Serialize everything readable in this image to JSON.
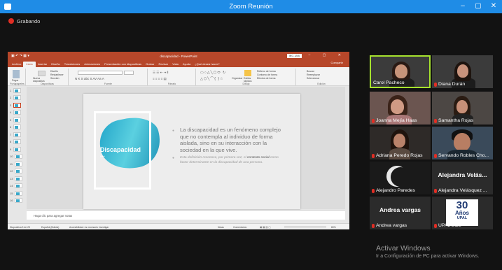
{
  "window": {
    "title": "Zoom Reunión",
    "minimize": "–",
    "maximize": "▢",
    "close": "✕"
  },
  "recording": {
    "label": "Grabando"
  },
  "powerpoint": {
    "title": "discapacidad - PowerPoint",
    "user_initials": "ING. ANA",
    "tabs": [
      "Archivo",
      "Inicio",
      "Insertar",
      "Diseño",
      "Transiciones",
      "Animaciones",
      "Presentación con diapositivas",
      "Grabar",
      "Revisar",
      "Vista",
      "Ayuda",
      "¿Qué desea hacer?"
    ],
    "active_tab": "Inicio",
    "share": "Compartir",
    "ribbon_groups": [
      "Portapapeles",
      "Diapositivas",
      "Fuente",
      "Párrafo",
      "Dibujo",
      "Edición"
    ],
    "ribbon_buttons": {
      "paste": "Pegar",
      "new_slide": "Nueva diapositiva",
      "layout": "Diseño",
      "reset": "Restablecer",
      "section": "Sección",
      "arrange": "Organizar",
      "quick_styles": "Estilos rápidos",
      "find": "Buscar",
      "replace": "Reemplazar",
      "select": "Seleccionar",
      "shape_fill": "Relleno de forma",
      "shape_outline": "Contorno de forma",
      "shape_effects": "Efectos de forma"
    },
    "slide_numbers": [
      "1",
      "2",
      "3",
      "4",
      "5",
      "6",
      "7",
      "8",
      "9",
      "10",
      "11",
      "12",
      "13",
      "14",
      "15",
      "16"
    ],
    "selected_slide": "3",
    "slide": {
      "title": "Discapacidad",
      "title_dots": "...",
      "bullet1": "La discapacidad es un fenómeno complejo que no contempla al individuo de forma aislada, sino en su interacción con la sociedad en la que vive.",
      "bullet2_a": "Esta definición reconoce, por primera vez,",
      "bullet2_b": "el ",
      "bullet2_em": "contexto social",
      "bullet2_c": " como factor determinante en la discapacidad de una persona."
    },
    "notes_placeholder": "Haga clic para agregar notas",
    "status": {
      "slide_count": "Diapositiva 3 de 23",
      "language": "Español (Bolivia)",
      "accessibility": "Accesibilidad: es necesario investigar",
      "notes": "Notas",
      "comments": "Comentarios",
      "zoom": "80%"
    }
  },
  "participants": [
    {
      "name": "Carol Pacheco",
      "active": true,
      "muted": false
    },
    {
      "name": "Diana Durán",
      "muted": true
    },
    {
      "name": "Joanna Mejía Haas",
      "muted": true
    },
    {
      "name": "Samantha Rojas",
      "muted": true
    },
    {
      "name": "Adriana Peredo Rojas",
      "muted": true
    },
    {
      "name": "Servando Robles Cho...",
      "muted": true
    },
    {
      "name": "Alejandro Paredes",
      "muted": true
    },
    {
      "name": "Alejandra Velás...",
      "name_full": "Alejandra Velásquez ...",
      "muted": true
    },
    {
      "name": "Andrea vargas",
      "muted": true
    },
    {
      "name": "UPAL BOL",
      "muted": true
    }
  ],
  "logo": {
    "number": "30",
    "years": "Años",
    "org": "UPAL"
  },
  "watermark": {
    "title": "Activar Windows",
    "subtitle": "Ir a Configuración de PC para activar Windows."
  },
  "colors": {
    "zoom_blue": "#1f8ce6",
    "ppt_orange": "#b7472a",
    "active_speaker": "#a6e22e",
    "muted_red": "#e02e24",
    "slide_accent": "#1fa3c8"
  }
}
